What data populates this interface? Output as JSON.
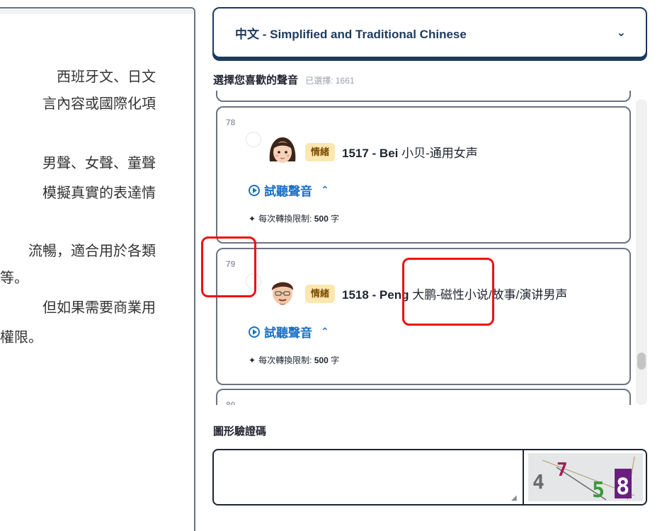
{
  "left_panel": {
    "lines": [
      "西班牙文、日文",
      "言內容或國際化項",
      "男聲、女聲、童聲",
      "模擬真實的表達情",
      "流暢，適合用於各類",
      "等。",
      "但如果需要商業用",
      "權限。"
    ]
  },
  "language_select": {
    "value": "中文 - Simplified and Traditional Chinese",
    "chevron_icon": "chevron-down-icon"
  },
  "voice_section": {
    "heading": "選擇您喜歡的聲音",
    "selected_text": "已選擇: 1661"
  },
  "voices": [
    {
      "number": "78",
      "tag": "情緒",
      "id_name": "1517 - Bei",
      "desc": "小贝-通用女声",
      "listen_label": "試聽聲音",
      "limit_label": "每次轉換限制:",
      "limit_value": "500",
      "limit_unit": "字",
      "avatar": "female-avatar-icon"
    },
    {
      "number": "79",
      "tag": "情緒",
      "id_name": "1518 - Peng",
      "desc": "大鹏-磁性小说/故事/演讲男声",
      "listen_label": "試聽聲音",
      "limit_label": "每次轉換限制:",
      "limit_value": "500",
      "limit_unit": "字",
      "avatar": "male-avatar-icon"
    },
    {
      "number": "80"
    }
  ],
  "captcha": {
    "label": "圖形驗證碼",
    "input_value": "",
    "image_chars": [
      "4",
      "7",
      "5",
      "8"
    ]
  },
  "colors": {
    "accent": "#1e3a5f",
    "link": "#1d6fc5",
    "tag_bg": "#fde7b0",
    "annotation": "#ee1111"
  }
}
